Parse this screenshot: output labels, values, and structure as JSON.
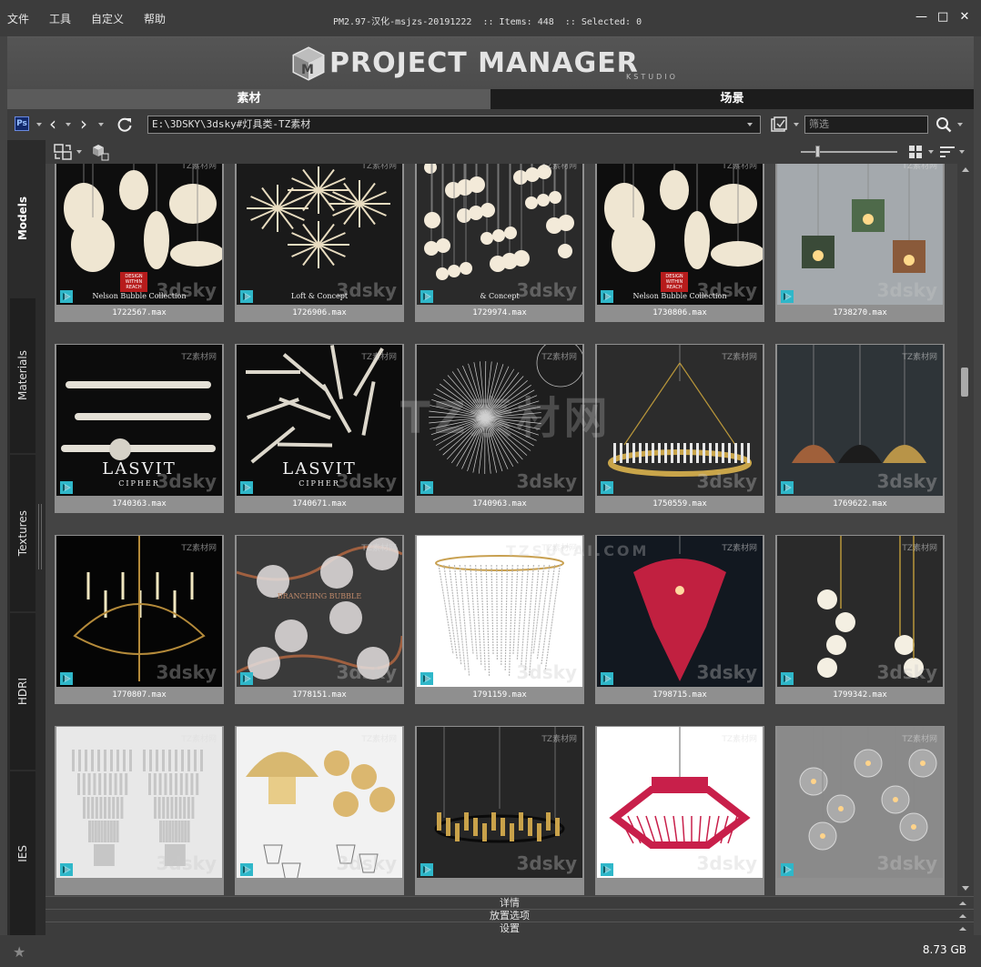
{
  "menu": [
    "文件",
    "工具",
    "自定义",
    "帮助"
  ],
  "title_info": "PM2.97-汉化-msjzs-20191222  :: Items: 448  :: Selected: 0",
  "window_controls": {
    "minimize": "—",
    "maximize": "□",
    "close": "✕"
  },
  "logo": {
    "text": "PROJECT MANAGER",
    "sub": "KSTUDIO"
  },
  "main_tabs": [
    {
      "label": "素材",
      "active": true
    },
    {
      "label": "场景",
      "active": false
    }
  ],
  "address": {
    "path": "E:\\3DSKY\\3dsky#灯具类-TZ素材",
    "filter_placeholder": "筛选",
    "ps_label": "Ps"
  },
  "sidebar_tabs": [
    {
      "label": "Models",
      "active": true
    },
    {
      "label": "Materials",
      "active": false
    },
    {
      "label": "Textures",
      "active": false
    },
    {
      "label": "HDRI",
      "active": false
    },
    {
      "label": "IES",
      "active": false
    }
  ],
  "grid_items": [
    {
      "label": "1722567.max",
      "bg": "#0e0e0e",
      "motif": "lanterns",
      "caption": "Nelson Bubble Collection",
      "badge": "DESIGN WITHIN REACH"
    },
    {
      "label": "1726906.max",
      "bg": "#1a1a1a",
      "motif": "starburst",
      "caption": "Loft & Concept",
      "badge": ""
    },
    {
      "label": "1729974.max",
      "bg": "#2a2a2a",
      "motif": "bubbles",
      "caption": "& Concept",
      "badge": ""
    },
    {
      "label": "1730806.max",
      "bg": "#0e0e0e",
      "motif": "lanterns",
      "caption": "Nelson Bubble Collection",
      "badge": "DESIGN WITHIN REACH"
    },
    {
      "label": "1738270.max",
      "bg": "#a4a9ad",
      "motif": "cubes",
      "caption": "",
      "badge": ""
    },
    {
      "label": "1740363.max",
      "bg": "#0c0c0c",
      "motif": "rods",
      "caption": "LASVIT",
      "badge": "CIPHER"
    },
    {
      "label": "1740671.max",
      "bg": "#0c0c0c",
      "motif": "sticks",
      "caption": "LASVIT",
      "badge": "CIPHER"
    },
    {
      "label": "1740963.max",
      "bg": "#1e1e1e",
      "motif": "sphere",
      "caption": "",
      "badge": ""
    },
    {
      "label": "1750559.max",
      "bg": "#2c2c2c",
      "motif": "ring",
      "caption": "",
      "badge": ""
    },
    {
      "label": "1769622.max",
      "bg": "#2e3438",
      "motif": "domes",
      "caption": "",
      "badge": ""
    },
    {
      "label": "1770807.max",
      "bg": "#050505",
      "motif": "chandelier",
      "caption": "",
      "badge": ""
    },
    {
      "label": "1778151.max",
      "bg": "#3a3a3a",
      "motif": "branching",
      "caption": "BRANCHING BUBBLE",
      "badge": ""
    },
    {
      "label": "1791159.max",
      "bg": "#ffffff",
      "motif": "crystal",
      "caption": "",
      "badge": ""
    },
    {
      "label": "1798715.max",
      "bg": "#121820",
      "motif": "redbell",
      "caption": "",
      "badge": ""
    },
    {
      "label": "1799342.max",
      "bg": "#2a2a2a",
      "motif": "globes",
      "caption": "",
      "badge": ""
    },
    {
      "label": "",
      "bg": "#e8e8e8",
      "motif": "tiers",
      "caption": "",
      "badge": ""
    },
    {
      "label": "",
      "bg": "#f2f2f2",
      "motif": "goldmesh",
      "caption": "",
      "badge": ""
    },
    {
      "label": "",
      "bg": "#262626",
      "motif": "blackring",
      "caption": "",
      "badge": ""
    },
    {
      "label": "",
      "bg": "#ffffff",
      "motif": "redcone",
      "caption": "",
      "badge": ""
    },
    {
      "label": "",
      "bg": "#8a8a8a",
      "motif": "glassdrops",
      "caption": "",
      "badge": ""
    }
  ],
  "watermark": {
    "site": "TZ素材网",
    "brand": "3dsky",
    "big": "TZ素材网",
    "big_sub": "TZSUCAI.COM"
  },
  "bottom_panels": [
    "详情",
    "放置选项",
    "设置"
  ],
  "status": {
    "disk_size": "8.73 GB"
  },
  "colors": {
    "accent": "#d9d9d9",
    "tab_active": "#5b5b5b",
    "tab_inactive": "#1c1c1c",
    "max_icon": "#2fb7c9"
  }
}
